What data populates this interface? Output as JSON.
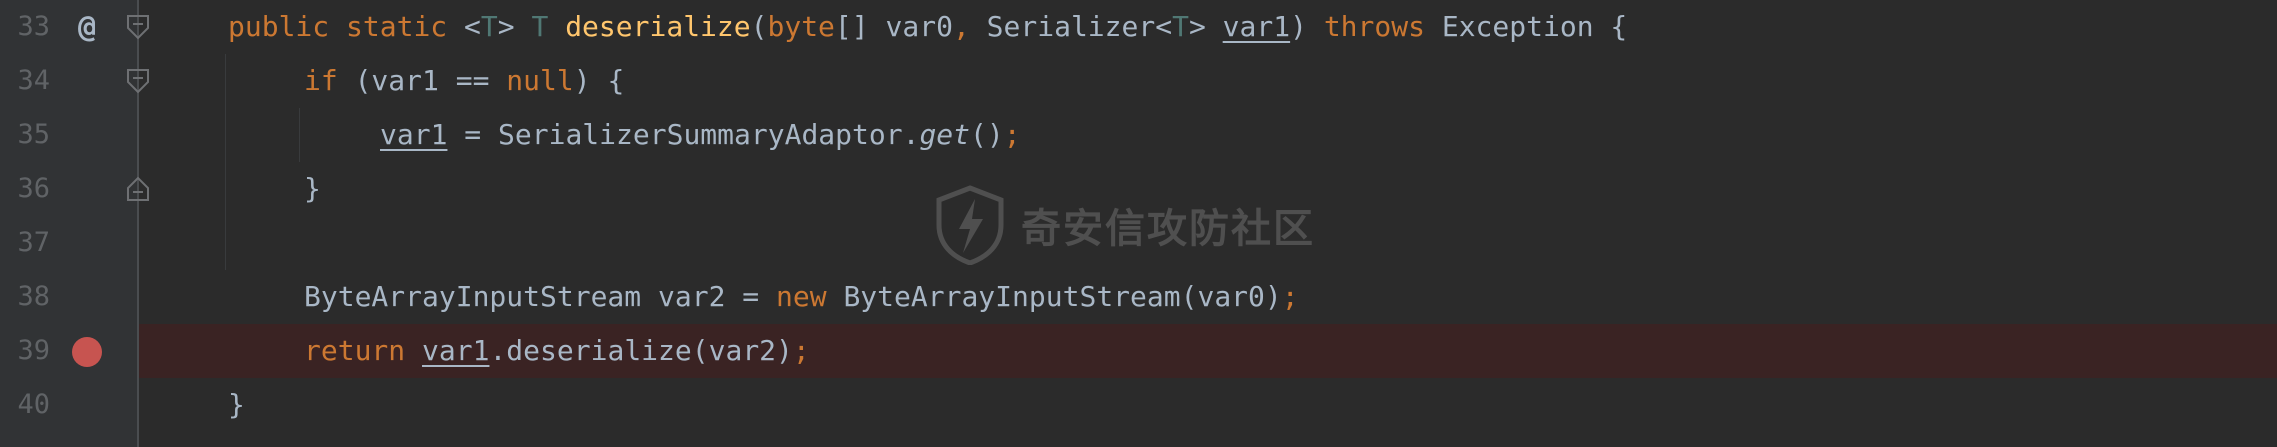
{
  "editor": {
    "lines": [
      {
        "number": "33"
      },
      {
        "number": "34"
      },
      {
        "number": "35"
      },
      {
        "number": "36"
      },
      {
        "number": "37"
      },
      {
        "number": "38"
      },
      {
        "number": "39"
      },
      {
        "number": "40"
      }
    ],
    "tokens": {
      "l33": {
        "public": "public",
        "static": "static",
        "lt": "<",
        "T1": "T",
        "gt": ">",
        "T2": "T",
        "method": "deserialize",
        "paren_open": "(",
        "byte": "byte",
        "arr": "[] var0",
        "comma": ",",
        "serializer": " Serializer",
        "lt2": "<",
        "T3": "T",
        "gt2": ">",
        "var1": "var1",
        "paren_close": ")",
        "throws": "throws",
        "exception": " Exception {"
      },
      "l34": {
        "if": "if",
        "cond_open": " (var1 == ",
        "null": "null",
        "cond_close": ") {"
      },
      "l35": {
        "var1": "var1",
        "assign": " = SerializerSummaryAdaptor.",
        "get": "get",
        "call": "()",
        "semi": ";"
      },
      "l36": {
        "brace": "}"
      },
      "l38": {
        "type": "ByteArrayInputStream var2 = ",
        "new": "new",
        "ctor": " ByteArrayInputStream(var0)",
        "semi": ";"
      },
      "l39": {
        "return": "return",
        "var1": "var1",
        "call": ".deserialize(var2)",
        "semi": ";"
      },
      "l40": {
        "brace": "}"
      }
    },
    "watermark": "奇安信攻防社区",
    "colors": {
      "background": "#2b2b2b",
      "gutter": "#313335",
      "keyword": "#cc7832",
      "method": "#ffc66d",
      "type_param": "#507874",
      "text": "#a9b7c6",
      "line_number": "#606366",
      "breakpoint": "#c75450",
      "breakpoint_line": "#3a2323"
    },
    "icons": {
      "override_marker": "at-icon",
      "breakpoint": "breakpoint-icon",
      "fold": "fold-icon"
    }
  }
}
